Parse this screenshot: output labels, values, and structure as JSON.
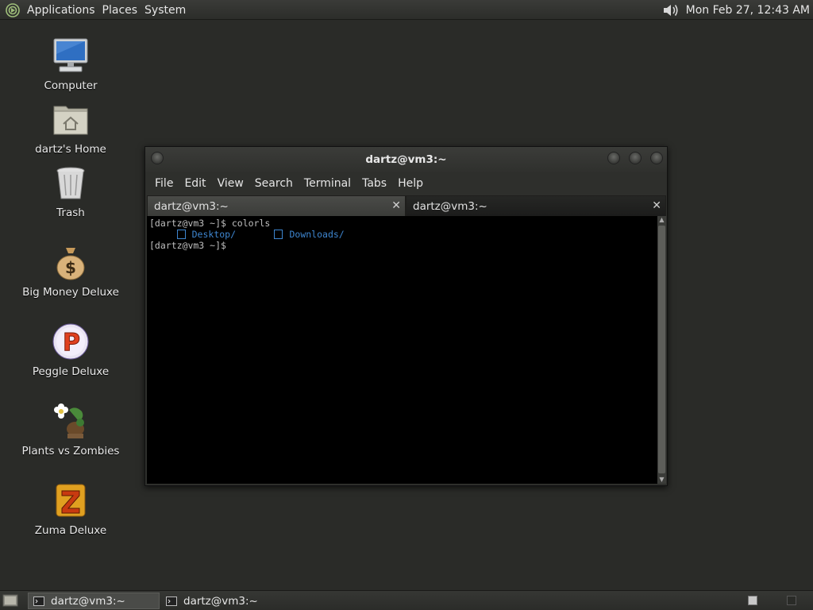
{
  "top_panel": {
    "menus": [
      "Applications",
      "Places",
      "System"
    ],
    "clock": "Mon Feb 27, 12:43 AM",
    "icons": {
      "logo": "gnome-foot-icon",
      "volume": "volume-icon"
    }
  },
  "desktop_icons": [
    {
      "label": "Computer",
      "icon": "computer-icon"
    },
    {
      "label": "dartz's Home",
      "icon": "home-folder-icon"
    },
    {
      "label": "Trash",
      "icon": "trash-icon"
    },
    {
      "label": "Big Money Deluxe",
      "icon": "money-bag-icon"
    },
    {
      "label": "Peggle Deluxe",
      "icon": "peggle-icon"
    },
    {
      "label": "Plants vs Zombies",
      "icon": "plants-vs-zombies-icon"
    },
    {
      "label": "Zuma Deluxe",
      "icon": "zuma-icon"
    }
  ],
  "terminal": {
    "title": "dartz@vm3:~",
    "menu": [
      "File",
      "Edit",
      "View",
      "Search",
      "Terminal",
      "Tabs",
      "Help"
    ],
    "tabs": [
      {
        "label": "dartz@vm3:~",
        "active": false
      },
      {
        "label": "dartz@vm3:~",
        "active": true
      }
    ],
    "close_glyph": "✕",
    "lines": {
      "prompt1": "[dartz@vm3 ~]$ ",
      "cmd1": "colorls",
      "dir1": "Desktop/",
      "dir2": "Downloads/",
      "prompt2": "[dartz@vm3 ~]$"
    },
    "colors": {
      "background": "#000000",
      "text": "#bfbfbf",
      "directory": "#3e86d0"
    }
  },
  "bottom_panel": {
    "tasks": [
      {
        "label": "dartz@vm3:~",
        "active": true
      },
      {
        "label": "dartz@vm3:~",
        "active": false
      }
    ],
    "workspaces": 2,
    "active_workspace": 1
  }
}
